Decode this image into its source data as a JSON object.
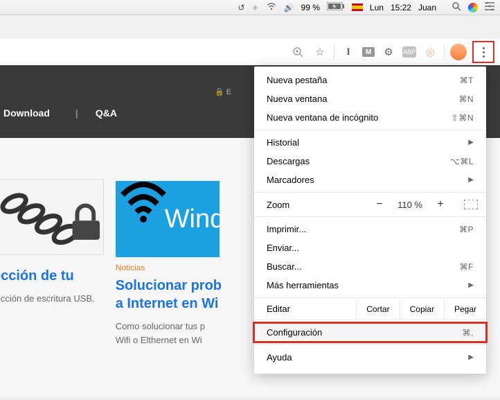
{
  "menubar": {
    "battery": "99 %",
    "charging": true,
    "day": "Lun",
    "time": "15:22",
    "user": "Juan"
  },
  "hero": {
    "nav": {
      "download": "Download",
      "qa": "Q&A"
    },
    "address_prefix": "E"
  },
  "cards": {
    "c1": {
      "title": "ección de tu",
      "body": "tección de escritura USB."
    },
    "c2": {
      "tag": "Noticias",
      "title": "Solucionar prob",
      "title2": "a Internet en Wi",
      "body1": "Como solucionar tus p",
      "body2": "Wifi o Elthernet en Wi",
      "wifi_text": "Wind"
    }
  },
  "menu": {
    "new_tab": "Nueva pestaña",
    "new_tab_sc": "⌘T",
    "new_win": "Nueva ventana",
    "new_win_sc": "⌘N",
    "incognito": "Nueva ventana de incógnito",
    "incognito_sc": "⇧⌘N",
    "history": "Historial",
    "downloads": "Descargas",
    "downloads_sc": "⌥⌘L",
    "bookmarks": "Marcadores",
    "zoom": "Zoom",
    "zoom_val": "110 %",
    "print": "Imprimir...",
    "print_sc": "⌘P",
    "send": "Enviar...",
    "find": "Buscar...",
    "find_sc": "⌘F",
    "more_tools": "Más herramientas",
    "edit": "Editar",
    "cut": "Cortar",
    "copy": "Copiar",
    "paste": "Pegar",
    "settings": "Configuración",
    "settings_sc": "⌘,",
    "help": "Ayuda"
  }
}
